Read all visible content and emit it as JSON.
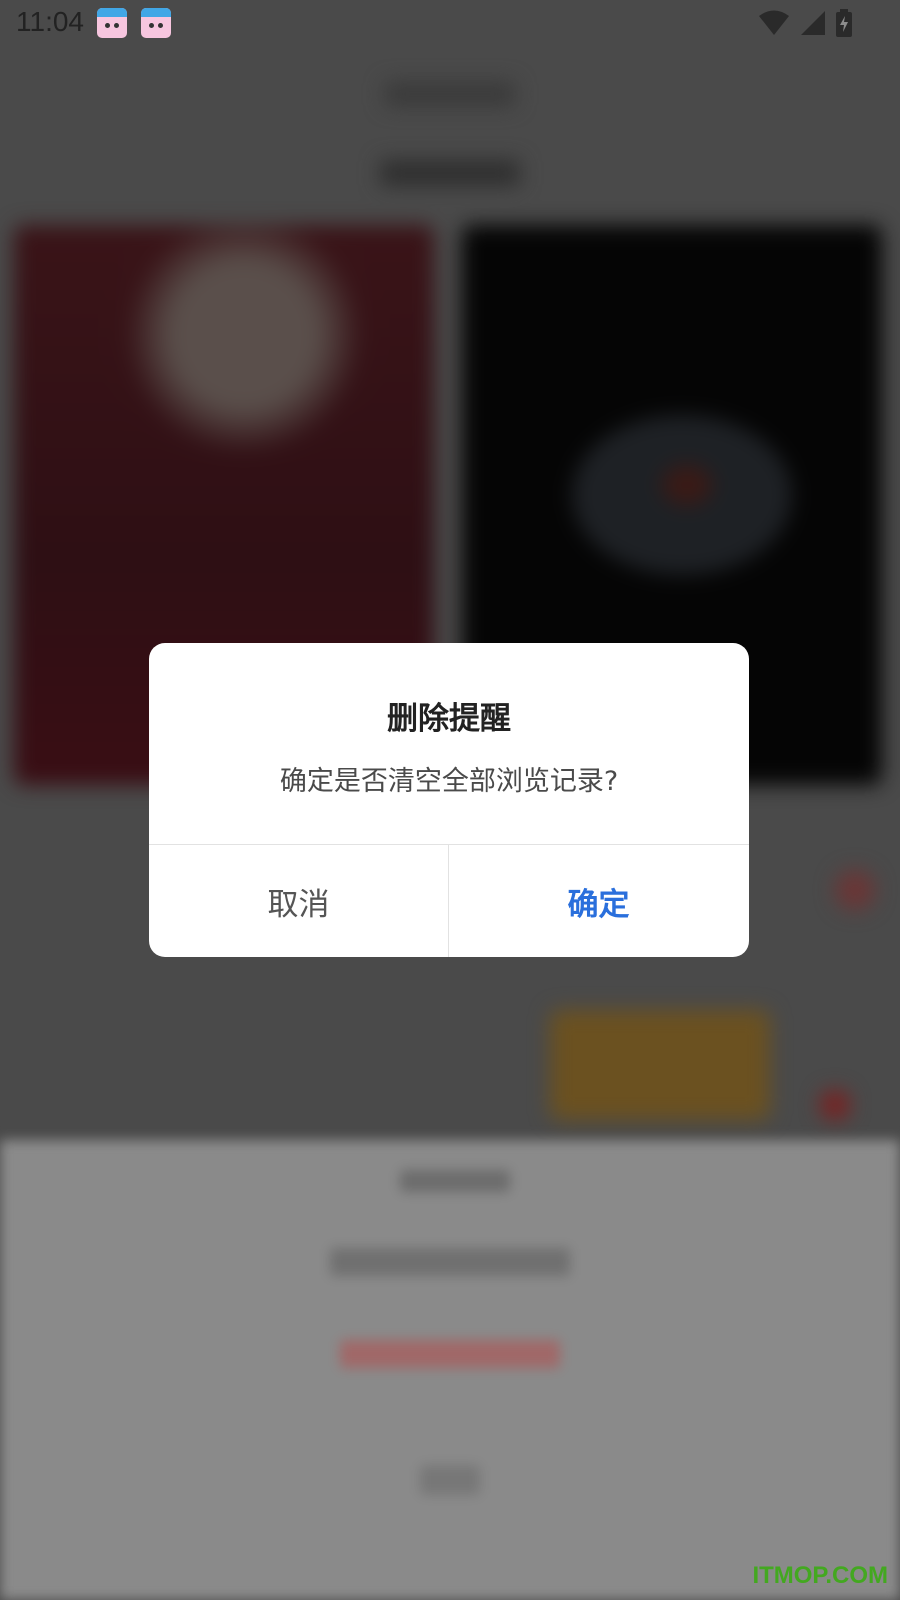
{
  "status_bar": {
    "time": "11:04",
    "app_icons": [
      "unicorn-app-icon",
      "unicorn-app-icon"
    ],
    "system_icons": [
      "wifi-icon",
      "signal-icon",
      "battery-charging-icon"
    ]
  },
  "dialog": {
    "title": "删除提醒",
    "message": "确定是否清空全部浏览记录?",
    "cancel_label": "取消",
    "confirm_label": "确定"
  },
  "watermark": "ITMOP.COM",
  "colors": {
    "confirm": "#2a6fdc",
    "overlay": "#4a4a4a",
    "watermark": "#43a820"
  }
}
